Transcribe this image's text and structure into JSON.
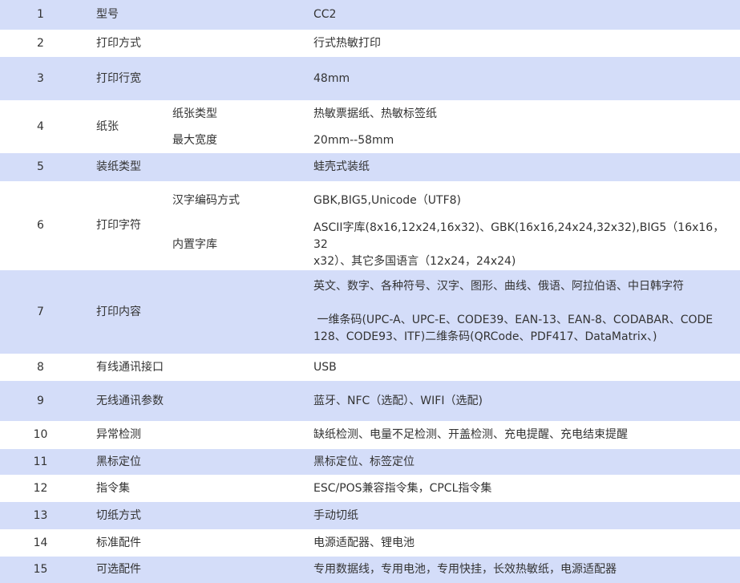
{
  "rows": [
    {
      "no": "1",
      "item": "型号",
      "value": "CC2"
    },
    {
      "no": "2",
      "item": "打印方式",
      "value": "行式热敏打印"
    },
    {
      "no": "3",
      "item": "打印行宽",
      "value": "48mm"
    },
    {
      "no": "4",
      "item": "纸张",
      "sub": [
        {
          "label": "纸张类型",
          "value": "热敏票据纸、热敏标签纸"
        },
        {
          "label": "最大宽度",
          "value": "20mm--58mm"
        }
      ]
    },
    {
      "no": "5",
      "item": "装纸类型",
      "value": "蛙壳式装纸"
    },
    {
      "no": "6",
      "item": "打印字符",
      "sub": [
        {
          "label": "汉字编码方式",
          "value": "GBK,BIG5,Unicode（UTF8)"
        },
        {
          "label": "内置字库",
          "value_lines": [
            "ASCII字库(8x16,12x24,16x32)、GBK(16x16,24x24,32x32),BIG5（16x16，32",
            "x32）、其它多国语言（12x24，24x24)"
          ]
        }
      ]
    },
    {
      "no": "7",
      "item": "打印内容",
      "value_lines": [
        "英文、数字、各种符号、汉字、图形、曲线、俄语、阿拉伯语、中日韩字符",
        "",
        " 一维条码(UPC-A、UPC-E、CODE39、EAN-13、EAN-8、CODABAR、CODE",
        "128、CODE93、ITF)二维条码(QRCode、PDF417、DataMatrix、)"
      ]
    },
    {
      "no": "8",
      "item": "有线通讯接口",
      "value": "USB"
    },
    {
      "no": "9",
      "item": "无线通讯参数",
      "value": "蓝牙、NFC（选配）、WIFI（选配)"
    },
    {
      "no": "10",
      "item": "异常检测",
      "value": "缺纸检测、电量不足检测、开盖检测、充电提醒、充电结束提醒"
    },
    {
      "no": "11",
      "item": "黑标定位",
      "value": "黑标定位、标签定位"
    },
    {
      "no": "12",
      "item": "指令集",
      "value": "ESC/POS兼容指令集，CPCL指令集"
    },
    {
      "no": "13",
      "item": "切纸方式",
      "value": "手动切纸"
    },
    {
      "no": "14",
      "item": "标准配件",
      "value": "电源适配器、锂电池"
    },
    {
      "no": "15",
      "item": "可选配件",
      "value": "专用数据线，专用电池，专用快挂，长效热敏纸，电源适配器"
    }
  ],
  "colors": {
    "band": "#d4ddf9",
    "text": "#333333"
  }
}
